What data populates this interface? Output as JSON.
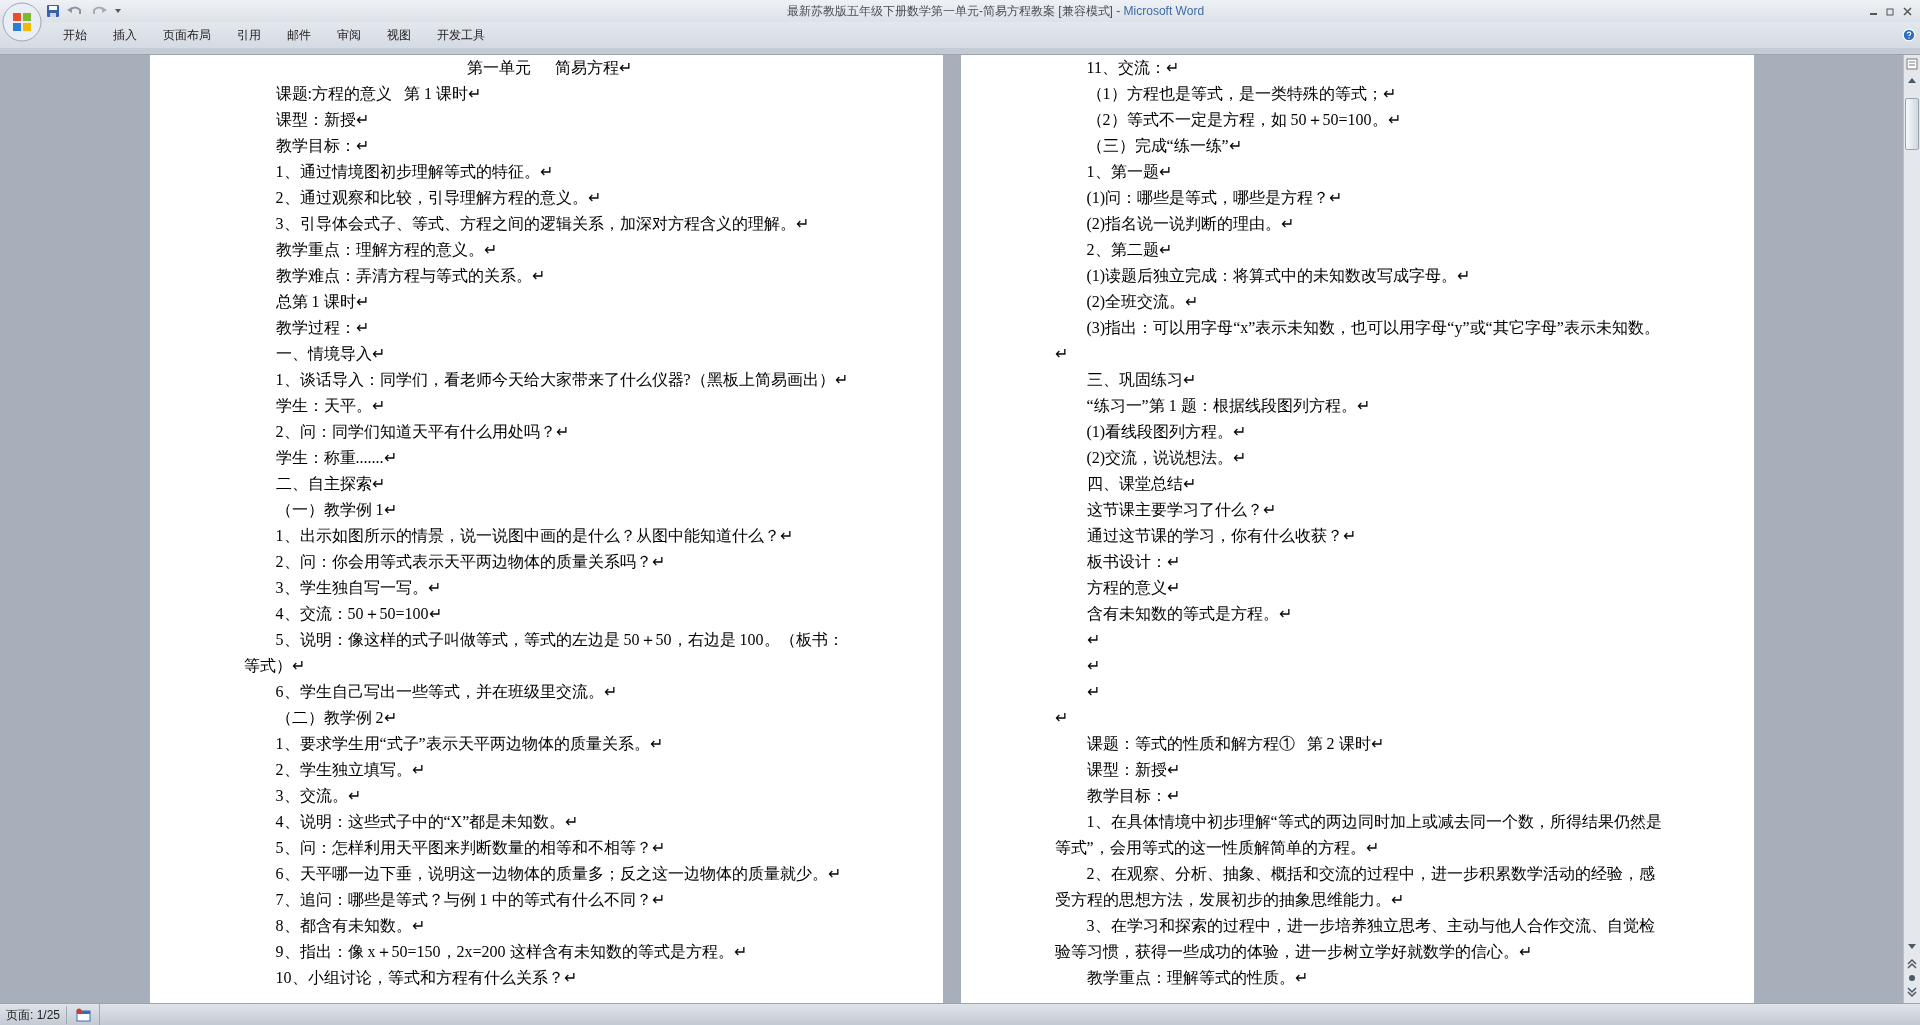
{
  "window": {
    "title": "最新苏教版五年级下册数学第一单元-简易方程教案 [兼容模式] - ",
    "app_name": "Microsoft Word"
  },
  "ribbon_tabs": [
    {
      "label": "开始"
    },
    {
      "label": "插入"
    },
    {
      "label": "页面布局"
    },
    {
      "label": "引用"
    },
    {
      "label": "邮件"
    },
    {
      "label": "审阅"
    },
    {
      "label": "视图"
    },
    {
      "label": "开发工具"
    }
  ],
  "pages": [
    {
      "paragraphs": [
        {
          "kind": "title",
          "text": "第一单元      简易方程↵"
        },
        {
          "kind": "para",
          "text": "课题:方程的意义   第 1 课时↵"
        },
        {
          "kind": "para",
          "text": "课型：新授↵"
        },
        {
          "kind": "para",
          "text": "教学目标：↵"
        },
        {
          "kind": "para",
          "text": "1、通过情境图初步理解等式的特征。↵"
        },
        {
          "kind": "para",
          "text": "2、通过观察和比较，引导理解方程的意义。↵"
        },
        {
          "kind": "para",
          "text": "3、引导体会式子、等式、方程之间的逻辑关系，加深对方程含义的理解。↵"
        },
        {
          "kind": "para",
          "text": "教学重点：理解方程的意义。↵"
        },
        {
          "kind": "para",
          "text": "教学难点：弄清方程与等式的关系。↵"
        },
        {
          "kind": "para",
          "text": "总第 1 课时↵"
        },
        {
          "kind": "para",
          "text": "教学过程：↵"
        },
        {
          "kind": "para",
          "text": "一、情境导入↵"
        },
        {
          "kind": "para",
          "text": "1、谈话导入：同学们，看老师今天给大家带来了什么仪器?（黑板上简易画出）↵"
        },
        {
          "kind": "para",
          "text": "学生：天平。↵"
        },
        {
          "kind": "para",
          "text": "2、问：同学们知道天平有什么用处吗？↵"
        },
        {
          "kind": "para",
          "text": "学生：称重.......↵"
        },
        {
          "kind": "para",
          "text": "二、自主探索↵"
        },
        {
          "kind": "para",
          "text": "（一）教学例 1↵"
        },
        {
          "kind": "para",
          "text": "1、出示如图所示的情景，说一说图中画的是什么？从图中能知道什么？↵"
        },
        {
          "kind": "para",
          "text": "2、问：你会用等式表示天平两边物体的质量关系吗？↵"
        },
        {
          "kind": "para",
          "text": "3、学生独自写一写。↵"
        },
        {
          "kind": "para",
          "text": "4、交流：50＋50=100↵"
        },
        {
          "kind": "para",
          "text": "5、说明：像这样的式子叫做等式，等式的左边是 50＋50，右边是 100。（板书：等式）↵"
        },
        {
          "kind": "para",
          "text": "6、学生自己写出一些等式，并在班级里交流。↵"
        },
        {
          "kind": "para",
          "text": "（二）教学例 2↵"
        },
        {
          "kind": "para",
          "text": "1、要求学生用“式子”表示天平两边物体的质量关系。↵"
        },
        {
          "kind": "para",
          "text": "2、学生独立填写。↵"
        },
        {
          "kind": "para",
          "text": "3、交流。↵"
        },
        {
          "kind": "para",
          "text": "4、说明：这些式子中的“X”都是未知数。↵"
        },
        {
          "kind": "para",
          "text": "5、问：怎样利用天平图来判断数量的相等和不相等？↵"
        },
        {
          "kind": "para",
          "text": "6、天平哪一边下垂，说明这一边物体的质量多；反之这一边物体的质量就少。↵"
        },
        {
          "kind": "para",
          "text": "7、追问：哪些是等式？与例 1 中的等式有什么不同？↵"
        },
        {
          "kind": "para",
          "text": "8、都含有未知数。↵"
        },
        {
          "kind": "para",
          "text": "9、指出：像 x＋50=150，2x=200 这样含有未知数的等式是方程。↵"
        },
        {
          "kind": "para",
          "text": "10、小组讨论，等式和方程有什么关系？↵"
        }
      ]
    },
    {
      "paragraphs": [
        {
          "kind": "para",
          "text": "11、交流：↵"
        },
        {
          "kind": "para",
          "text": "（1）方程也是等式，是一类特殊的等式；↵"
        },
        {
          "kind": "para",
          "text": "（2）等式不一定是方程，如 50＋50=100。↵"
        },
        {
          "kind": "para",
          "text": "（三）完成“练一练”↵"
        },
        {
          "kind": "para",
          "text": "1、第一题↵"
        },
        {
          "kind": "para",
          "text": "(1)问：哪些是等式，哪些是方程？↵"
        },
        {
          "kind": "para",
          "text": "(2)指名说一说判断的理由。↵"
        },
        {
          "kind": "para",
          "text": "2、第二题↵"
        },
        {
          "kind": "para",
          "text": "(1)读题后独立完成：将算式中的未知数改写成字母。↵"
        },
        {
          "kind": "para",
          "text": "(2)全班交流。↵"
        },
        {
          "kind": "para",
          "text": "(3)指出：可以用字母“x”表示未知数，也可以用字母“y”或“其它字母”表示未知数。↵"
        },
        {
          "kind": "para",
          "text": "三、巩固练习↵"
        },
        {
          "kind": "para",
          "text": "“练习一”第 1 题：根据线段图列方程。↵"
        },
        {
          "kind": "para",
          "text": "(1)看线段图列方程。↵"
        },
        {
          "kind": "para",
          "text": "(2)交流，说说想法。↵"
        },
        {
          "kind": "para",
          "text": "四、课堂总结↵"
        },
        {
          "kind": "para",
          "text": "这节课主要学习了什么？↵"
        },
        {
          "kind": "para",
          "text": "通过这节课的学习，你有什么收获？↵"
        },
        {
          "kind": "para",
          "text": "板书设计：↵"
        },
        {
          "kind": "para",
          "text": "方程的意义↵"
        },
        {
          "kind": "para",
          "text": "含有未知数的等式是方程。↵"
        },
        {
          "kind": "para",
          "text": "↵"
        },
        {
          "kind": "para",
          "text": "↵"
        },
        {
          "kind": "para",
          "text": "↵"
        },
        {
          "kind": "flush",
          "text": "↵"
        },
        {
          "kind": "para",
          "text": "课题：等式的性质和解方程①   第 2 课时↵"
        },
        {
          "kind": "para",
          "text": "课型：新授↵"
        },
        {
          "kind": "para",
          "text": "教学目标：↵"
        },
        {
          "kind": "para",
          "text": "1、在具体情境中初步理解“等式的两边同时加上或减去同一个数，所得结果仍然是等式”，会用等式的这一性质解简单的方程。↵"
        },
        {
          "kind": "para",
          "text": "2、在观察、分析、抽象、概括和交流的过程中，进一步积累数学活动的经验，感受方程的思想方法，发展初步的抽象思维能力。↵"
        },
        {
          "kind": "para",
          "text": "3、在学习和探索的过程中，进一步培养独立思考、主动与他人合作交流、自觉检验等习惯，获得一些成功的体验，进一步树立学好就数学的信心。↵"
        },
        {
          "kind": "para",
          "text": "教学重点：理解等式的性质。↵"
        }
      ]
    }
  ],
  "status_bar": {
    "page": "页面: 1/25"
  }
}
